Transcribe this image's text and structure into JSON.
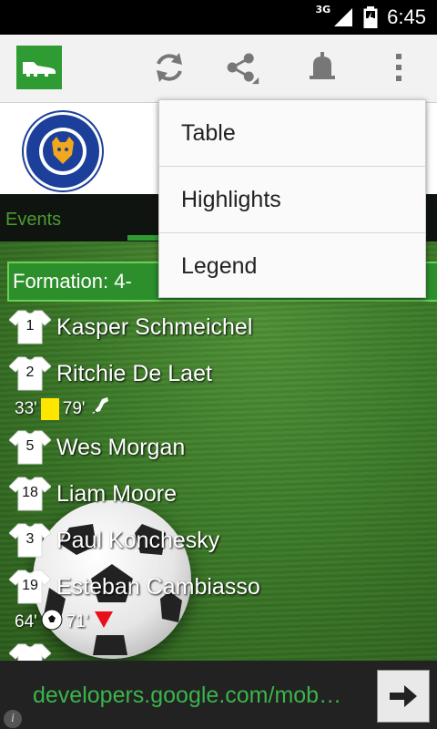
{
  "status_bar": {
    "network": "3G",
    "time": "6:45"
  },
  "tabs": [
    {
      "label": "Events"
    }
  ],
  "formation_label": "Formation: 4-",
  "players": [
    {
      "number": "1",
      "name": "Kasper Schmeichel"
    },
    {
      "number": "2",
      "name": "Ritchie De Laet",
      "events": {
        "card_minute": "33'",
        "sub_minute": "79'"
      }
    },
    {
      "number": "5",
      "name": "Wes Morgan"
    },
    {
      "number": "18",
      "name": "Liam Moore"
    },
    {
      "number": "3",
      "name": "Paul Konchesky"
    },
    {
      "number": "19",
      "name": "Esteban Cambiasso",
      "events": {
        "goal_minute": "64'",
        "sub_minute": "71'"
      }
    }
  ],
  "overflow_menu": {
    "items": [
      {
        "label": "Table"
      },
      {
        "label": "Highlights"
      },
      {
        "label": "Legend"
      }
    ]
  },
  "ad": {
    "text": "developers.google.com/mob…"
  },
  "colors": {
    "accent": "#2e9b33",
    "ad_text": "#3ab54a",
    "yellow_card": "#ffe600"
  },
  "icons": [
    "football-boot-icon",
    "refresh-icon",
    "share-icon",
    "bell-icon",
    "overflow-menu-icon",
    "arrow-right-icon",
    "info-icon"
  ]
}
